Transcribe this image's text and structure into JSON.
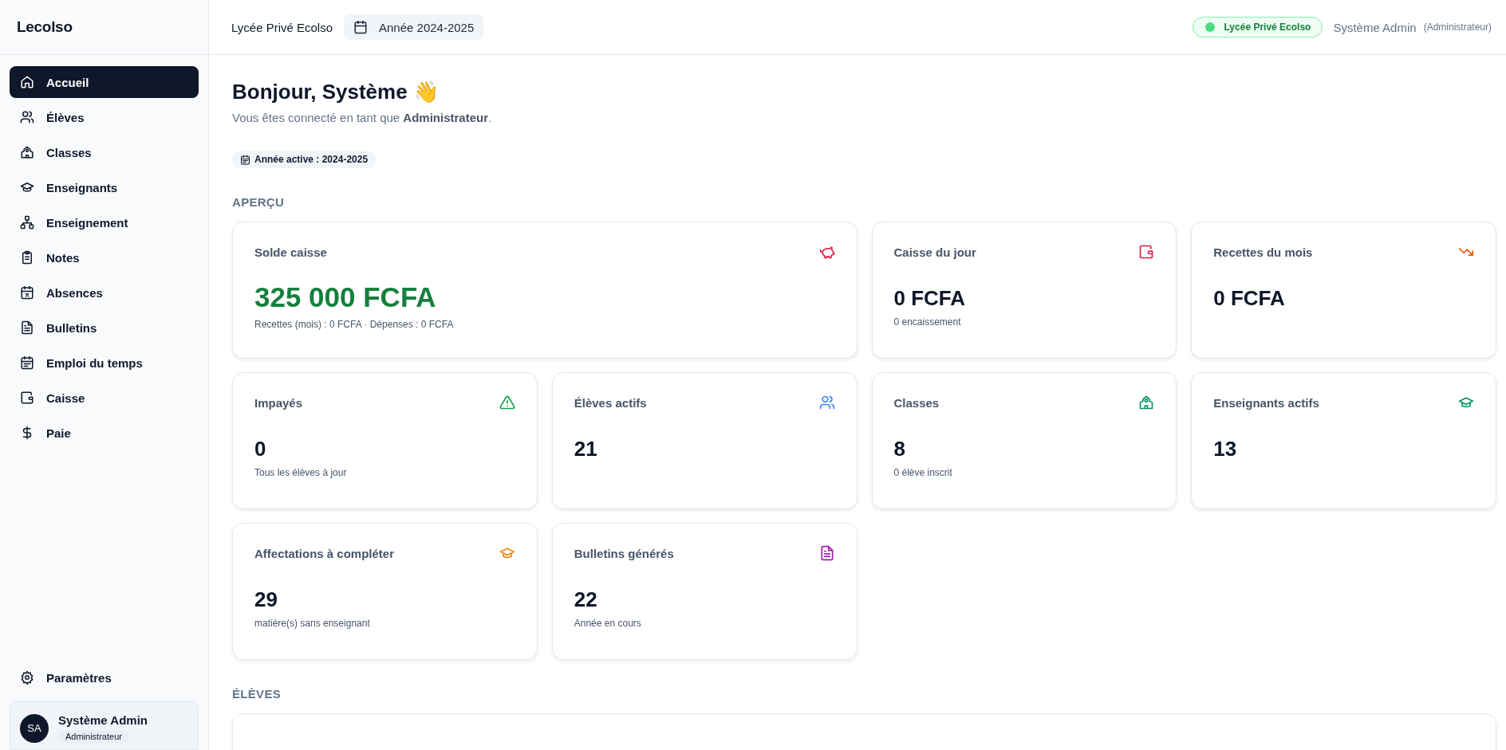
{
  "sidebar": {
    "logo": "Lecolso",
    "items": [
      {
        "label": "Accueil",
        "selected": true
      },
      {
        "label": "Élèves",
        "selected": false
      },
      {
        "label": "Classes",
        "selected": false
      },
      {
        "label": "Enseignants",
        "selected": false
      },
      {
        "label": "Enseignement",
        "selected": false
      },
      {
        "label": "Notes",
        "selected": false
      },
      {
        "label": "Absences",
        "selected": false
      },
      {
        "label": "Bulletins",
        "selected": false
      },
      {
        "label": "Emploi du temps",
        "selected": false
      },
      {
        "label": "Caisse",
        "selected": false
      },
      {
        "label": "Paie",
        "selected": false
      }
    ],
    "settings": {
      "label": "Paramètres",
      "selected": false
    },
    "user": {
      "initials": "SA",
      "name": "Système Admin",
      "role": "Administrateur"
    }
  },
  "topbar": {
    "school": "Lycée Privé Ecolso",
    "year": "Année 2024-2025",
    "school_badge": "Lycée Privé Ecolso",
    "user_name": "Système Admin",
    "user_role": "(Administrateur)"
  },
  "greeting": {
    "title": "Bonjour, Système 👋",
    "subtitle": "Vous êtes connecté en tant que **Administrateur**.",
    "active_year": "Année active : 2024-2025"
  },
  "sections": [
    {
      "title": "APERÇU",
      "cards": [
        {
          "kind": "wide",
          "title": "Solde caisse",
          "value": "325 000 FCFA",
          "note": "Recettes (mois) : 0 FCFA · Dépenses : 0 FCFA",
          "color": "#e11d48"
        },
        {
          "kind": "stat",
          "title": "Caisse du jour",
          "value": "0 FCFA",
          "note": "0 encaissement",
          "color": "#e11d48"
        },
        {
          "kind": "stat",
          "title": "Recettes du mois",
          "value": "0 FCFA",
          "color": "#ea580c"
        },
        {
          "kind": "stat",
          "title": "Impayés",
          "value": "0",
          "note": "Tous les élèves à jour",
          "color": "#16a34a"
        },
        {
          "kind": "stat",
          "title": "Élèves actifs",
          "value": "21",
          "color": "#3b82f6"
        },
        {
          "kind": "stat",
          "title": "Classes",
          "value": "8",
          "note": "0 élève inscrit",
          "color": "#059669"
        },
        {
          "kind": "stat",
          "title": "Enseignants actifs",
          "value": "13",
          "color": "#059669"
        },
        {
          "kind": "stat",
          "title": "Affectations à compléter",
          "value": "29",
          "note": "matière(s) sans enseignant",
          "color": "#ea8a0c"
        },
        {
          "kind": "stat",
          "title": "Bulletins générés",
          "value": "22",
          "note": "Année en cours",
          "color": "#a21caf"
        }
      ]
    },
    {
      "title": "ÉLÈVES"
    }
  ]
}
